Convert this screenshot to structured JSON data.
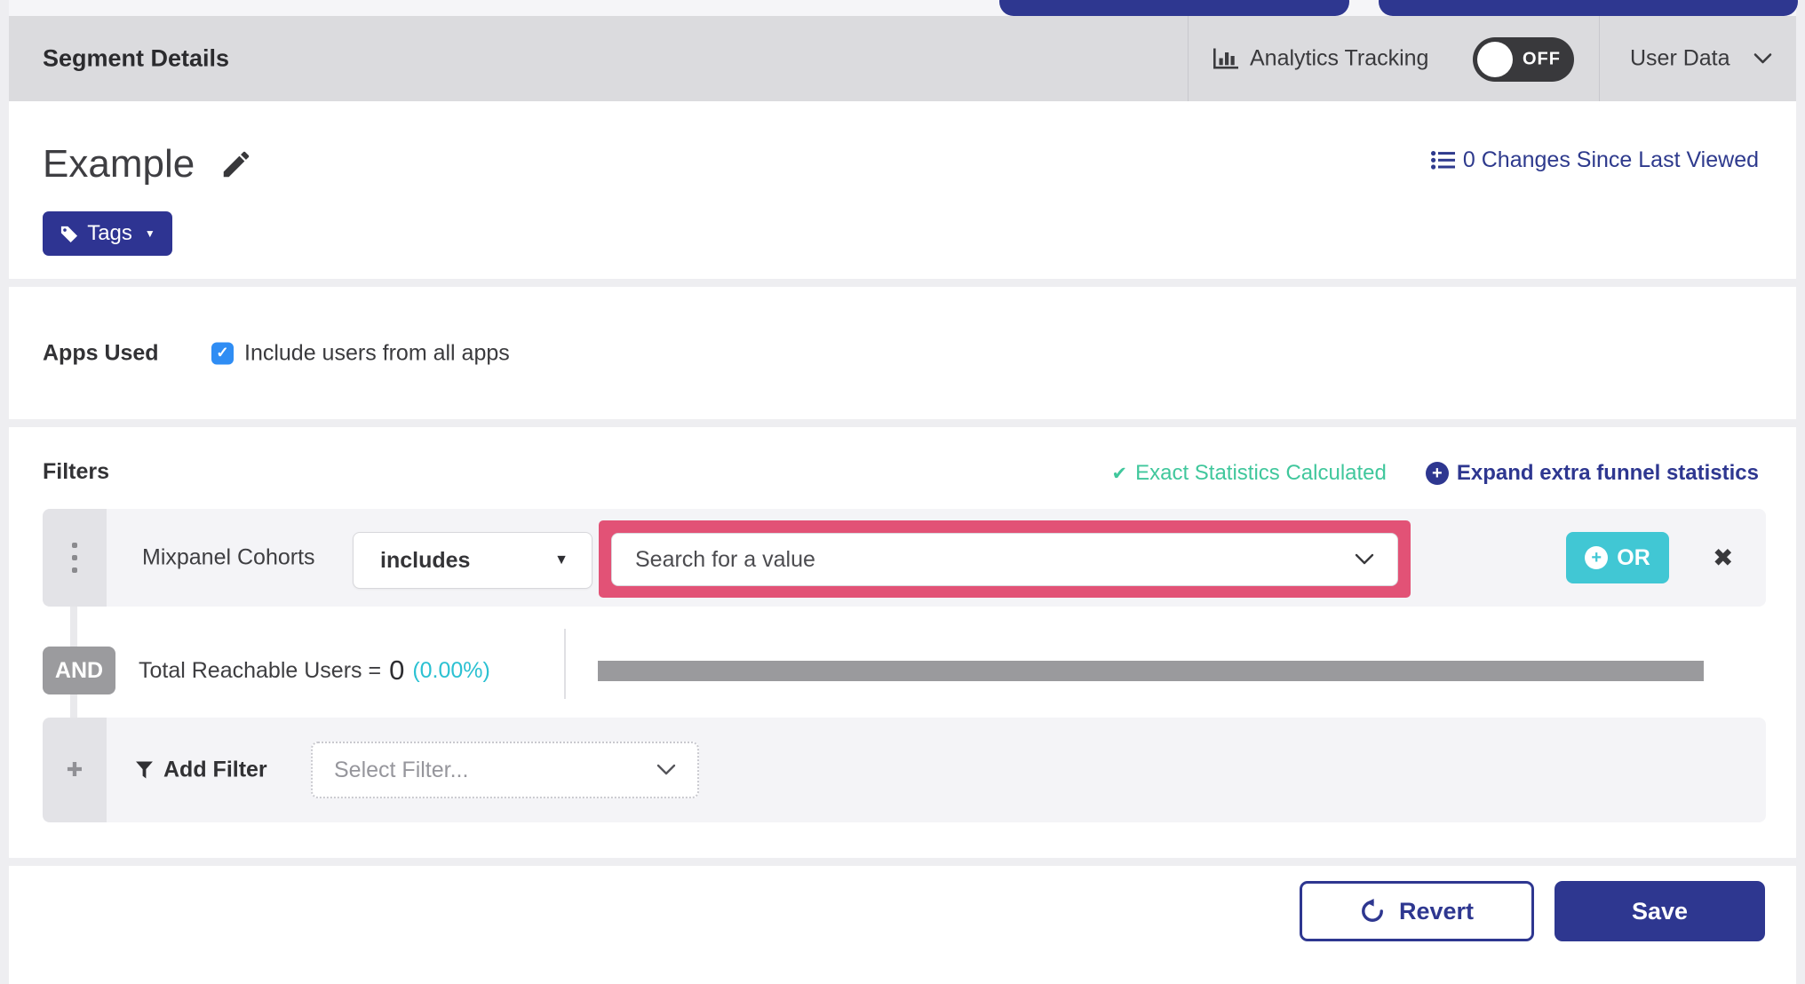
{
  "header": {
    "title": "Segment Details",
    "analytics_tracking": {
      "label": "Analytics Tracking",
      "toggle_state": "OFF"
    },
    "user_data": {
      "label": "User Data"
    }
  },
  "segment": {
    "name": "Example",
    "changes_link": "0 Changes Since Last Viewed",
    "tags_button": "Tags"
  },
  "apps_used": {
    "label": "Apps Used",
    "include_all_label": "Include users from all apps",
    "checked": true
  },
  "filters": {
    "heading": "Filters",
    "exact_statistics": "Exact Statistics Calculated",
    "expand_funnel_link": "Expand extra funnel statistics",
    "filter_row": {
      "field": "Mixpanel Cohorts",
      "operator": "includes",
      "value_placeholder": "Search for a value",
      "or_button": "OR"
    },
    "conjunction": "AND",
    "reachable": {
      "label": "Total Reachable Users =",
      "value": "0",
      "percent": "(0.00%)"
    },
    "add_filter": {
      "label": "Add Filter",
      "placeholder": "Select Filter..."
    }
  },
  "footer": {
    "revert_button": "Revert",
    "save_button": "Save"
  },
  "icons": {
    "check": "✓",
    "exact_check": "✔",
    "close": "✖",
    "caret_down": "▼",
    "plus": "+",
    "add_plus": "✚"
  },
  "colors": {
    "indigo": "#2e3790",
    "teal_or": "#41c7d4",
    "cyan_percent": "#2bc1d2",
    "green_stats": "#40c79c",
    "pink_highlight": "#e25276",
    "checkbox_blue": "#2f8df4",
    "toggle_off_bg": "#39393c",
    "progress_gray": "#9a9a9d",
    "header_gray": "#dbdbde"
  }
}
